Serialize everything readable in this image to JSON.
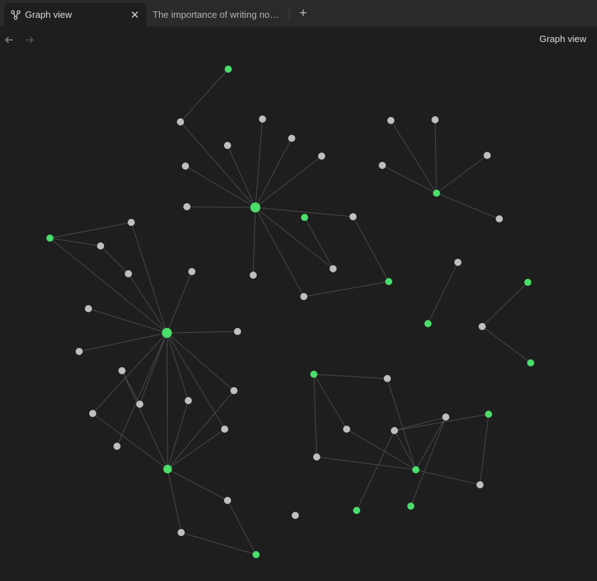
{
  "tabs": [
    {
      "label": "Graph view",
      "icon": "graph-icon",
      "active": true,
      "close_icon": "close-icon"
    },
    {
      "label": "The importance of writing no…",
      "active": false
    }
  ],
  "new_tab_icon": "plus-icon",
  "nav": {
    "back_icon": "arrow-left-icon",
    "forward_icon": "arrow-right-icon"
  },
  "view_title": "Graph view",
  "colors": {
    "background": "#1e1e1e",
    "tabbar": "#2a2a2a",
    "node_note": "#bfbfbf",
    "node_attachment": "#4ade6a",
    "edge": "#4a4a4a"
  },
  "graph": {
    "node_count": 62,
    "edge_count": 65
  }
}
